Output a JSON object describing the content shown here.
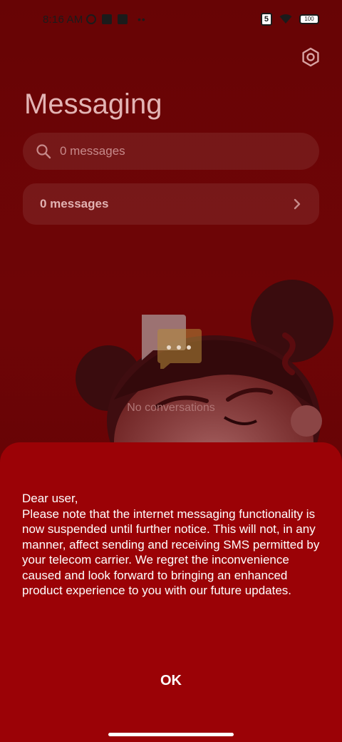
{
  "status_bar": {
    "time": "8:16 AM",
    "sim_label": "5",
    "battery": "100"
  },
  "app": {
    "title": "Messaging"
  },
  "search": {
    "placeholder": "0 messages"
  },
  "message_row": {
    "label": "0 messages"
  },
  "empty_state": {
    "text": "No conversations"
  },
  "dialog": {
    "body": "Dear user,\nPlease note that the internet messaging functionality is now suspended until further notice. This will not, in any manner, affect sending and receiving SMS permitted by your telecom carrier. We regret the inconvenience caused and look forward to bringing an enhanced product experience to you with our future updates.",
    "ok_label": "OK"
  },
  "colors": {
    "background": "#7a0507",
    "dialog": "#9b0206",
    "text": "#ffffff"
  },
  "icons": {
    "settings": "gear-icon",
    "search": "search-icon",
    "chevron": "chevron-right-icon",
    "empty": "chat-bubble-icon"
  }
}
